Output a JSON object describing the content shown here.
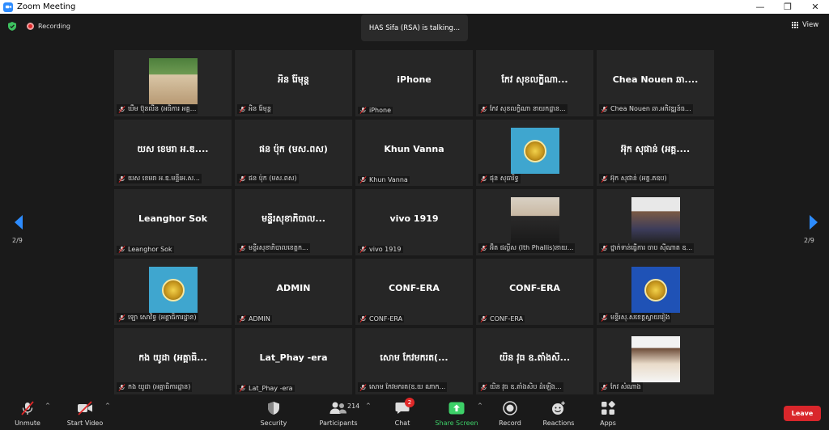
{
  "window": {
    "title": "Zoom Meeting"
  },
  "topbar": {
    "recording_label": "Recording",
    "talking_text": "HAS Sifa (RSA) is talking...",
    "view_label": "View"
  },
  "pagination": {
    "left": "2/9",
    "right": "2/9"
  },
  "tiles": [
    {
      "big": "",
      "label": "ឃឹម ប៊ុនលីន (អធិការ អគ្គ...",
      "pic": "photo-group"
    },
    {
      "big": "អិន រ៉ែមុន្ត",
      "label": "អិន រ៉ែមុន្ត"
    },
    {
      "big": "iPhone",
      "label": "iPhone"
    },
    {
      "big": "កែវ សុខលក្ខិណា...",
      "label": "កែវ សុខលក្ខិណា នាយកដ្ឋាន..."
    },
    {
      "big": "Chea  Nouen ឆា....",
      "label": "Chea Nouen ឆា.អភិវឌ្ឍន៍ធ..."
    },
    {
      "big": "យស ខេមរា អ.ឌ....",
      "label": "យស ខេមរា អ.ឌ.មន្ទីរអ.ស..."
    },
    {
      "big": "ផន ប៉ុក (មស.ពស)",
      "label": "ផន ប៉ុក (មស.ពស)"
    },
    {
      "big": "Khun Vanna",
      "label": "Khun Vanna"
    },
    {
      "big": "",
      "label": "ផុន សុធារិទ្ធ",
      "pic": "logo"
    },
    {
      "big": "អ៊ុក សុផាន់ (អគ្គ....",
      "label": "អ៊ុក សុផាន់ (អគ្គ.គឧប)"
    },
    {
      "big": "Leanghor Sok",
      "label": "Leanghor Sok"
    },
    {
      "big": "មន្ទីរសុខាភិបាល...",
      "label": "មន្ទីរសុខាភិបាលខេត្តក..."
    },
    {
      "big": "vivo 1919",
      "label": "vivo 1919"
    },
    {
      "big": "",
      "label": "អ៊ិត ផល្លីស (Ith Phallis)នាយ...",
      "pic": "photo-woman"
    },
    {
      "big": "",
      "label": "ថ្នាក់ទាន់ធ្វើការ ចាប ស៊ីណាត ឧ...",
      "pic": "photo-man"
    },
    {
      "big": "",
      "label": "ឡោ សោវិទ្ធ (អគ្គាធិការដ្ឋាន)",
      "pic": "logo"
    },
    {
      "big": "ADMIN",
      "label": "ADMIN"
    },
    {
      "big": "CONF-ERA",
      "label": "CONF-ERA"
    },
    {
      "big": "CONF-ERA",
      "label": "CONF-ERA"
    },
    {
      "big": "",
      "label": "មន្ទីរសុ.សខេត្តស្វាយរៀង",
      "pic": "logo dark"
    },
    {
      "big": "កង យូដា (អគ្គាធិ...",
      "label": "កង យូដា (អគ្គាធិការដ្ឋាន)"
    },
    {
      "big": "Lat_Phay -era",
      "label": "Lat_Phay -era"
    },
    {
      "big": "សោម កែវមករត(...",
      "label": "សោម កែវមករត(ឧ.យ ណាក..."
    },
    {
      "big": "យិន វុធ ឧ.តាំងសិ...",
      "label": "យិន វុធ ឧ.តាំងសិប ដំឡើង..."
    },
    {
      "big": "",
      "label": "កែវ សំណាង",
      "pic": "photo-woman2"
    }
  ],
  "toolbar": {
    "unmute": "Unmute",
    "start_video": "Start Video",
    "security": "Security",
    "participants": "Participants",
    "participants_count": "214",
    "chat": "Chat",
    "chat_badge": "2",
    "share_screen": "Share Screen",
    "record": "Record",
    "reactions": "Reactions",
    "apps": "Apps",
    "leave": "Leave"
  },
  "colors": {
    "accent": "#2d8cff",
    "share": "#3dd068",
    "leave": "#d9262b",
    "muted": "#e02828"
  }
}
